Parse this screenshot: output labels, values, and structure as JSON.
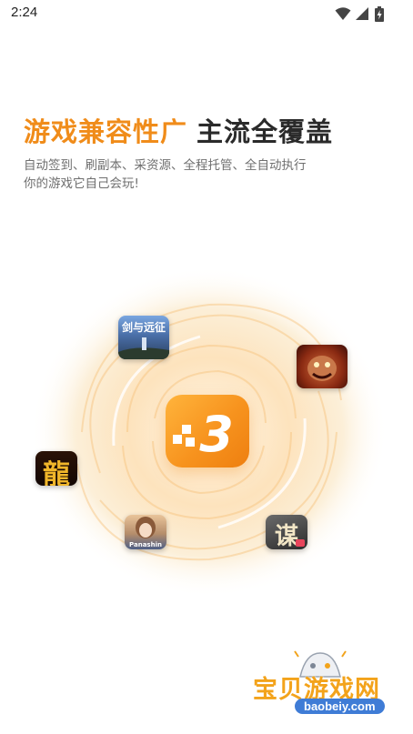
{
  "status_bar": {
    "time": "2:24",
    "icons": [
      "wifi-icon",
      "signal-icon",
      "battery-charging-icon"
    ]
  },
  "hero": {
    "title_highlight": "游戏兼容性广",
    "title_rest": "主流全覆盖",
    "subtitle_line1": "自动签到、刷副本、采资源、全程托管、全自动执行",
    "subtitle_line2": "你的游戏它自己会玩!"
  },
  "center_logo": {
    "glyph": "3"
  },
  "game_icons": {
    "top_left": {
      "caption": "剑与远征"
    },
    "left": {
      "caption": "龍"
    },
    "bottom_right": {
      "caption": "谋"
    },
    "bottom_left": {
      "caption": "Panashin"
    }
  },
  "watermark": {
    "name": "宝贝游戏网",
    "url": "baobeiy.com"
  },
  "colors": {
    "accent_orange": "#f08c1a",
    "title_dark": "#2a2a2a",
    "subtitle_gray": "#6f6f6f",
    "watermark_yellow": "#f3a31b",
    "watermark_blue": "#3f7cd6"
  }
}
